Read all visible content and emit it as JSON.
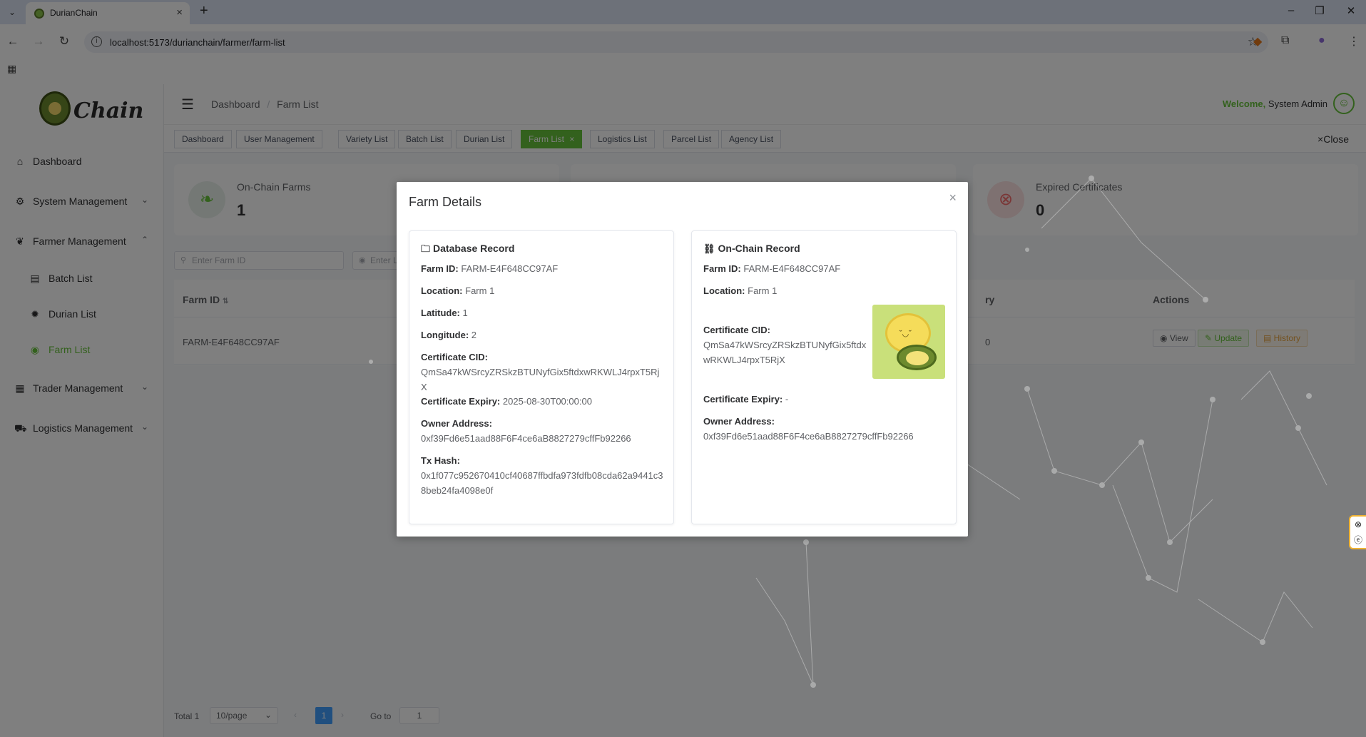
{
  "browser": {
    "tab_title": "DurianChain",
    "url": "localhost:5173/durianchain/farmer/farm-list"
  },
  "sidebar": {
    "logo_text": "Chain",
    "items": [
      {
        "label": "Dashboard",
        "icon": "home-icon"
      },
      {
        "label": "System Management",
        "icon": "gear-icon"
      },
      {
        "label": "Farmer Management",
        "icon": "leaf-icon"
      },
      {
        "label": "Batch List",
        "icon": "clipboard-icon"
      },
      {
        "label": "Durian List",
        "icon": "durian-icon"
      },
      {
        "label": "Farm List",
        "icon": "location-icon"
      },
      {
        "label": "Trader Management",
        "icon": "store-icon"
      },
      {
        "label": "Logistics Management",
        "icon": "truck-icon"
      }
    ]
  },
  "navbar": {
    "breadcrumb_home": "Dashboard",
    "breadcrumb_sep": "/",
    "breadcrumb_current": "Farm List",
    "welcome": "Welcome,",
    "user": "System Admin"
  },
  "tags": {
    "items": [
      "Dashboard",
      "User Management",
      "Variety List",
      "Batch List",
      "Durian List",
      "Farm List",
      "Logistics List",
      "Parcel List",
      "Agency List"
    ],
    "active_close": "×",
    "close_label": "Close"
  },
  "stats": {
    "on_chain_label": "On-Chain Farms",
    "on_chain_value": "1",
    "expired_label": "Expired Certificates",
    "expired_value": "0"
  },
  "filters": {
    "farm_id_placeholder": "Enter Farm ID",
    "location_placeholder": "Enter L"
  },
  "table": {
    "col_farm_id": "Farm ID",
    "col_expiry_partial": "ry",
    "col_actions": "Actions",
    "row_farm_id": "FARM-E4F648CC97AF",
    "row_expiry_partial": "0",
    "btn_view": "View",
    "btn_update": "Update",
    "btn_history": "History"
  },
  "pagination": {
    "total": "Total 1",
    "page_size": "10/page",
    "current": "1",
    "goto_label": "Go to",
    "goto_value": "1"
  },
  "modal": {
    "title": "Farm Details",
    "db": {
      "heading": "Database Record",
      "farm_id_label": "Farm ID:",
      "farm_id": "FARM-E4F648CC97AF",
      "location_label": "Location:",
      "location": "Farm 1",
      "latitude_label": "Latitude:",
      "latitude": "1",
      "longitude_label": "Longitude:",
      "longitude": "2",
      "cid_label": "Certificate CID:",
      "cid": "QmSa47kWSrcyZRSkzBTUNyfGix5ftdxwRKWLJ4rpxT5RjX",
      "expiry_label": "Certificate Expiry:",
      "expiry": "2025-08-30T00:00:00",
      "owner_label": "Owner Address:",
      "owner": "0xf39Fd6e51aad88F6F4ce6aB8827279cffFb92266",
      "tx_label": "Tx Hash:",
      "tx": "0x1f077c952670410cf40687ffbdfa973fdfb08cda62a9441c38beb24fa4098e0f"
    },
    "chain": {
      "heading": "On-Chain Record",
      "farm_id_label": "Farm ID:",
      "farm_id": "FARM-E4F648CC97AF",
      "location_label": "Location:",
      "location": "Farm 1",
      "cid_label": "Certificate CID:",
      "cid": "QmSa47kWSrcyZRSkzBTUNyfGix5ftdxwRKWLJ4rpxT5RjX",
      "expiry_label": "Certificate Expiry:",
      "expiry": "-",
      "owner_label": "Owner Address:",
      "owner": "0xf39Fd6e51aad88F6F4ce6aB8827279cffFb92266"
    }
  },
  "colors": {
    "accent": "#67c23a",
    "primary": "#409eff",
    "warning": "#e6a23c",
    "danger": "#f56c6c"
  }
}
